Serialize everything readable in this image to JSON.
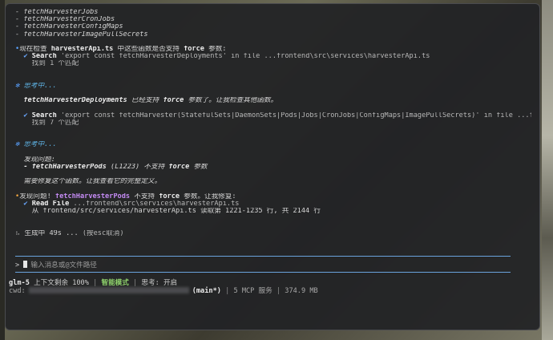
{
  "list_top": [
    "- fetchHarvesterJobs",
    "- fetchHarvesterCronJobs",
    "- fetchHarvesterConfigMaps",
    "- fetchHarvesterImagePullSecrets"
  ],
  "block1": {
    "pre": "现在检查 ",
    "file": "harvesterApi.ts",
    "mid": " 中这些函数是否支持 ",
    "kw": "force",
    "post": " 参数:",
    "tool": "Search",
    "query": " 'export const fetchHarvesterDeployments' in file ...frontend\\src\\services\\harvesterApi.ts",
    "result": "找到 1 个匹配"
  },
  "think1": {
    "label": "思考中...",
    "pre": "fetchHarvesterDeployments",
    "mid": " 已经支持 ",
    "kw": "force",
    "post": " 参数了。让我检查其他函数。"
  },
  "block2": {
    "tool": "Search",
    "query": " 'export const fetchHarvester(StatefulSets|DaemonSets|Pods|Jobs|CronJobs|ConfigMaps|ImagePullSecrets)' in file ...frontend\\src...",
    "result": "找到 7 个匹配"
  },
  "think2": {
    "label": "思考中...",
    "head": "发现问题:",
    "item_pre": "- fetchHarvesterPods",
    "item_mid": " (L1223) 不支持 ",
    "item_kw": "force",
    "item_post": " 参数",
    "note": "需要修复这个函数。让我查看它的完整定义。"
  },
  "block3": {
    "pre": "发现问题! ",
    "fn": "fetchHarvesterPods",
    "mid": " 不支持 ",
    "kw": "force",
    "post": " 参数。让我修复:",
    "tool": "Read File",
    "path": " ...frontend\\src\\services\\harvesterApi.ts",
    "result": "从 frontend/src/services/harvesterApi.ts 读取第 1221-1235 行, 共 2144 行"
  },
  "generating": {
    "label": "生成中 49s ...",
    "hint": "(按esc取消)"
  },
  "input": {
    "prompt": ">",
    "placeholder": "输入消息或@文件路径"
  },
  "status": {
    "model": "glm-5",
    "context": "上下文剩余 100%",
    "mode": "智能模式",
    "thinking": "思考: 开启",
    "cwd_label": "cwd:",
    "branch": "(main*)",
    "mcp": "5 MCP 服务",
    "memory": "374.9 MB"
  },
  "colors": {
    "accent": "#6aa3dd",
    "background": "#222325",
    "think": "#5aa2ff",
    "check": "#6aa8ff"
  },
  "icons": {
    "check": "checkmark-icon",
    "info": "info-dot-icon",
    "think": "asterisk-icon",
    "spinner": "spinner-icon"
  }
}
